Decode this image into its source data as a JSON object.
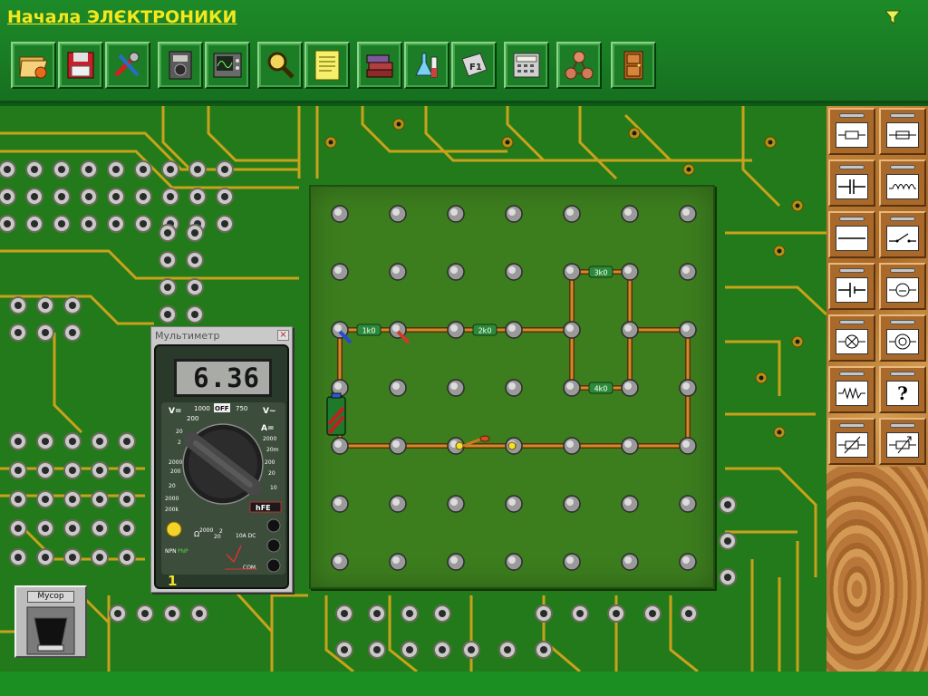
{
  "app": {
    "title": "Начала ЭЛЄКТРОНИКИ"
  },
  "icons": {
    "filter": "filter-funnel-icon"
  },
  "toolbar": [
    {
      "name": "open-file",
      "icon": "folder-open-icon"
    },
    {
      "name": "save",
      "icon": "floppy-disk-icon"
    },
    {
      "name": "tools",
      "icon": "pliers-screwdriver-icon"
    },
    {
      "name": "multimeter",
      "icon": "multimeter-icon"
    },
    {
      "name": "oscilloscope",
      "icon": "oscilloscope-icon"
    },
    {
      "name": "inspect",
      "icon": "magnifier-icon"
    },
    {
      "name": "notes",
      "icon": "notepad-icon"
    },
    {
      "name": "library",
      "icon": "books-icon"
    },
    {
      "name": "lab",
      "icon": "chemistry-lab-icon"
    },
    {
      "name": "help-f1",
      "icon": "f1-key-icon"
    },
    {
      "name": "calculator",
      "icon": "calculator-icon"
    },
    {
      "name": "molecule",
      "icon": "molecule-icon"
    },
    {
      "name": "exit",
      "icon": "door-exit-icon"
    }
  ],
  "circuit": {
    "resistor_labels": [
      "1k0",
      "2k0",
      "3k0",
      "4k0"
    ],
    "wire_color": "#d08a2a",
    "board_color": "#3c7d1e"
  },
  "multimeter": {
    "title": "Мультиметр",
    "close_label": "×",
    "reading": "6.36",
    "range_number": "1",
    "dial_labels": {
      "v_dc": "V=",
      "v_ac": "V~",
      "off": "OFF",
      "v1000": "1000",
      "v200": "200",
      "v750": "750",
      "amp": "A=",
      "hfe": "hFE",
      "ohm": "Ω",
      "ten_a_dc": "10A DC",
      "com": "COM",
      "npn": "NPN",
      "pnp": "PNP"
    }
  },
  "trash": {
    "label": "Мусор"
  },
  "palette": [
    {
      "name": "resistor",
      "icon": "resistor-icon"
    },
    {
      "name": "fuse",
      "icon": "fuse-icon"
    },
    {
      "name": "capacitor",
      "icon": "capacitor-icon"
    },
    {
      "name": "inductor",
      "icon": "inductor-coil-icon"
    },
    {
      "name": "wire",
      "icon": "wire-icon"
    },
    {
      "name": "switch",
      "icon": "switch-icon"
    },
    {
      "name": "battery",
      "icon": "battery-icon"
    },
    {
      "name": "ammeter",
      "icon": "meter-icon"
    },
    {
      "name": "lamp",
      "icon": "lamp-icon"
    },
    {
      "name": "spiral",
      "icon": "spiral-coil-icon"
    },
    {
      "name": "thermistor",
      "icon": "zigzag-resistor-icon"
    },
    {
      "name": "unknown",
      "icon": "question-mark-icon",
      "text": "?"
    },
    {
      "name": "variable-resistor",
      "icon": "variable-resistor-icon"
    },
    {
      "name": "potentiometer",
      "icon": "potentiometer-icon"
    }
  ]
}
